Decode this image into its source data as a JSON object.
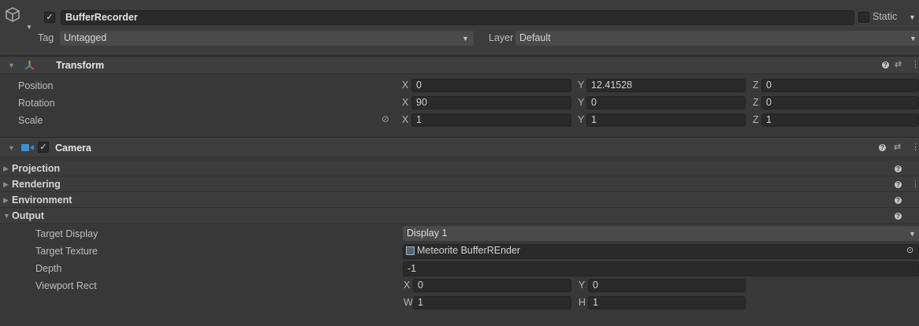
{
  "object": {
    "active": true,
    "name": "BufferRecorder",
    "static_label": "Static",
    "tag_label": "Tag",
    "tag_value": "Untagged",
    "layer_label": "Layer",
    "layer_value": "Default"
  },
  "transform": {
    "title": "Transform",
    "rows": [
      {
        "label": "Position",
        "x": "0",
        "y": "12.41528",
        "z": "0"
      },
      {
        "label": "Rotation",
        "x": "90",
        "y": "0",
        "z": "0"
      },
      {
        "label": "Scale",
        "x": "1",
        "y": "1",
        "z": "1"
      }
    ],
    "axis": {
      "x": "X",
      "y": "Y",
      "z": "Z"
    }
  },
  "camera": {
    "title": "Camera",
    "enabled": true,
    "sections": [
      "Projection",
      "Rendering",
      "Environment",
      "Output"
    ],
    "output": {
      "target_display_label": "Target Display",
      "target_display_value": "Display 1",
      "target_texture_label": "Target Texture",
      "target_texture_value": "Meteorite BufferREnder",
      "depth_label": "Depth",
      "depth_value": "-1",
      "viewport_label": "Viewport Rect",
      "viewport": {
        "x_label": "X",
        "x": "0",
        "y_label": "Y",
        "y": "0",
        "w_label": "W",
        "w": "1",
        "h_label": "H",
        "h": "1"
      }
    }
  },
  "icons": {
    "gameobject": "cube-icon",
    "transform": "transform-axes-icon",
    "camera": "camera-icon",
    "help": "help-icon",
    "presets": "presets-icon",
    "menu": "kebab-menu-icon",
    "constrain": "constrain-proportions-icon",
    "texture": "render-texture-icon",
    "picker": "object-picker-icon"
  },
  "colors": {
    "background": "#383838",
    "header": "#3e3e3e",
    "field": "#2a2a2a",
    "camera_icon": "#3b8fd6"
  }
}
